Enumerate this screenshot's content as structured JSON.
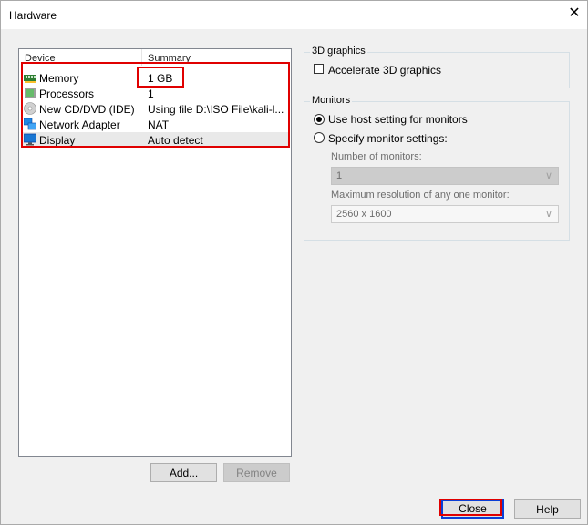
{
  "window": {
    "title": "Hardware",
    "close_glyph": "✕"
  },
  "device_list": {
    "headers": {
      "device": "Device",
      "summary": "Summary"
    },
    "rows": [
      {
        "device": "Memory",
        "summary": "1 GB",
        "icon": "memory-icon"
      },
      {
        "device": "Processors",
        "summary": "1",
        "icon": "processor-icon"
      },
      {
        "device": "New CD/DVD (IDE)",
        "summary": "Using file D:\\ISO File\\kali-l...",
        "icon": "cd-dvd-icon"
      },
      {
        "device": "Network Adapter",
        "summary": "NAT",
        "icon": "network-adapter-icon"
      },
      {
        "device": "Display",
        "summary": "Auto detect",
        "icon": "display-icon"
      }
    ],
    "selected": "Display"
  },
  "list_buttons": {
    "add": "Add...",
    "remove": "Remove"
  },
  "graphics": {
    "label": "3D graphics",
    "accelerate_label": "Accelerate 3D graphics",
    "accelerate_checked": false
  },
  "monitors": {
    "label": "Monitors",
    "host_setting_label": "Use host setting for monitors",
    "specify_label": "Specify monitor settings:",
    "selected_option": "host",
    "number_label": "Number of monitors:",
    "number_value": "1",
    "resolution_label": "Maximum resolution of any one monitor:",
    "resolution_value": "2560 x 1600"
  },
  "footer": {
    "close": "Close",
    "help": "Help"
  },
  "colors": {
    "highlight_box": "#e00000",
    "close_button_border": "#0a3fd6"
  }
}
